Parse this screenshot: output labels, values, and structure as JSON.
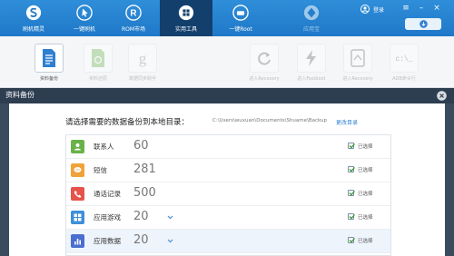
{
  "topbar": {
    "nav": [
      {
        "label": "刷机精灵",
        "icon": "shield-s-icon"
      },
      {
        "label": "一键刷机",
        "icon": "cursor-icon"
      },
      {
        "label": "ROM市场",
        "icon": "r-circle-icon"
      },
      {
        "label": "实用工具",
        "icon": "grid-icon"
      },
      {
        "label": "一键Root",
        "icon": "root-icon"
      },
      {
        "label": "应用宝",
        "icon": "yingyongbao-icon"
      }
    ],
    "active_index": 3,
    "login_label": "登录",
    "window_buttons": {
      "menu": "≡",
      "minimize": "–",
      "close": "×"
    }
  },
  "toolbar": {
    "tools": [
      {
        "label": "资料备份",
        "icon": "document-icon",
        "state": "active"
      },
      {
        "label": "资料还原",
        "icon": "restore-icon",
        "state": "faded"
      },
      {
        "label": "数据同步助手",
        "icon": "google-g-icon",
        "state": "faded"
      },
      {
        "label": "进入Recovery",
        "icon": "refresh-icon",
        "state": "faded"
      },
      {
        "label": "进入Fastboot",
        "icon": "lightning-icon",
        "state": "faded"
      },
      {
        "label": "进入Recovery",
        "icon": "tablet-icon",
        "state": "faded"
      },
      {
        "label": "ADB命令行",
        "icon": "terminal-icon",
        "state": "faded"
      }
    ]
  },
  "dialog": {
    "title": "资料备份",
    "prompt": "请选择需要的数据备份到本地目录：",
    "path": "C:\\Users\\wuxuan\\Documents\\Shuame\\Backup",
    "change_dir": "更改目录",
    "selected_label": "已选择",
    "rows": [
      {
        "name": "联系人",
        "count": "60",
        "icon": "contacts-icon",
        "color": "#6ab24a",
        "dropdown": false
      },
      {
        "name": "短信",
        "count": "281",
        "icon": "sms-icon",
        "color": "#f0a23a",
        "dropdown": false
      },
      {
        "name": "通话记录",
        "count": "500",
        "icon": "phone-icon",
        "color": "#e5534b",
        "dropdown": false
      },
      {
        "name": "应用游戏",
        "count": "20",
        "icon": "apps-icon",
        "color": "#3e8fd9",
        "dropdown": true
      },
      {
        "name": "应用数据",
        "count": "20",
        "icon": "app-data-icon",
        "color": "#4a6ed0",
        "dropdown": true
      }
    ]
  },
  "colors": {
    "topbar": "#2684d2",
    "active_nav": "#123f6c",
    "dialog_title": "#2e3e51",
    "link": "#2f7fd1"
  }
}
